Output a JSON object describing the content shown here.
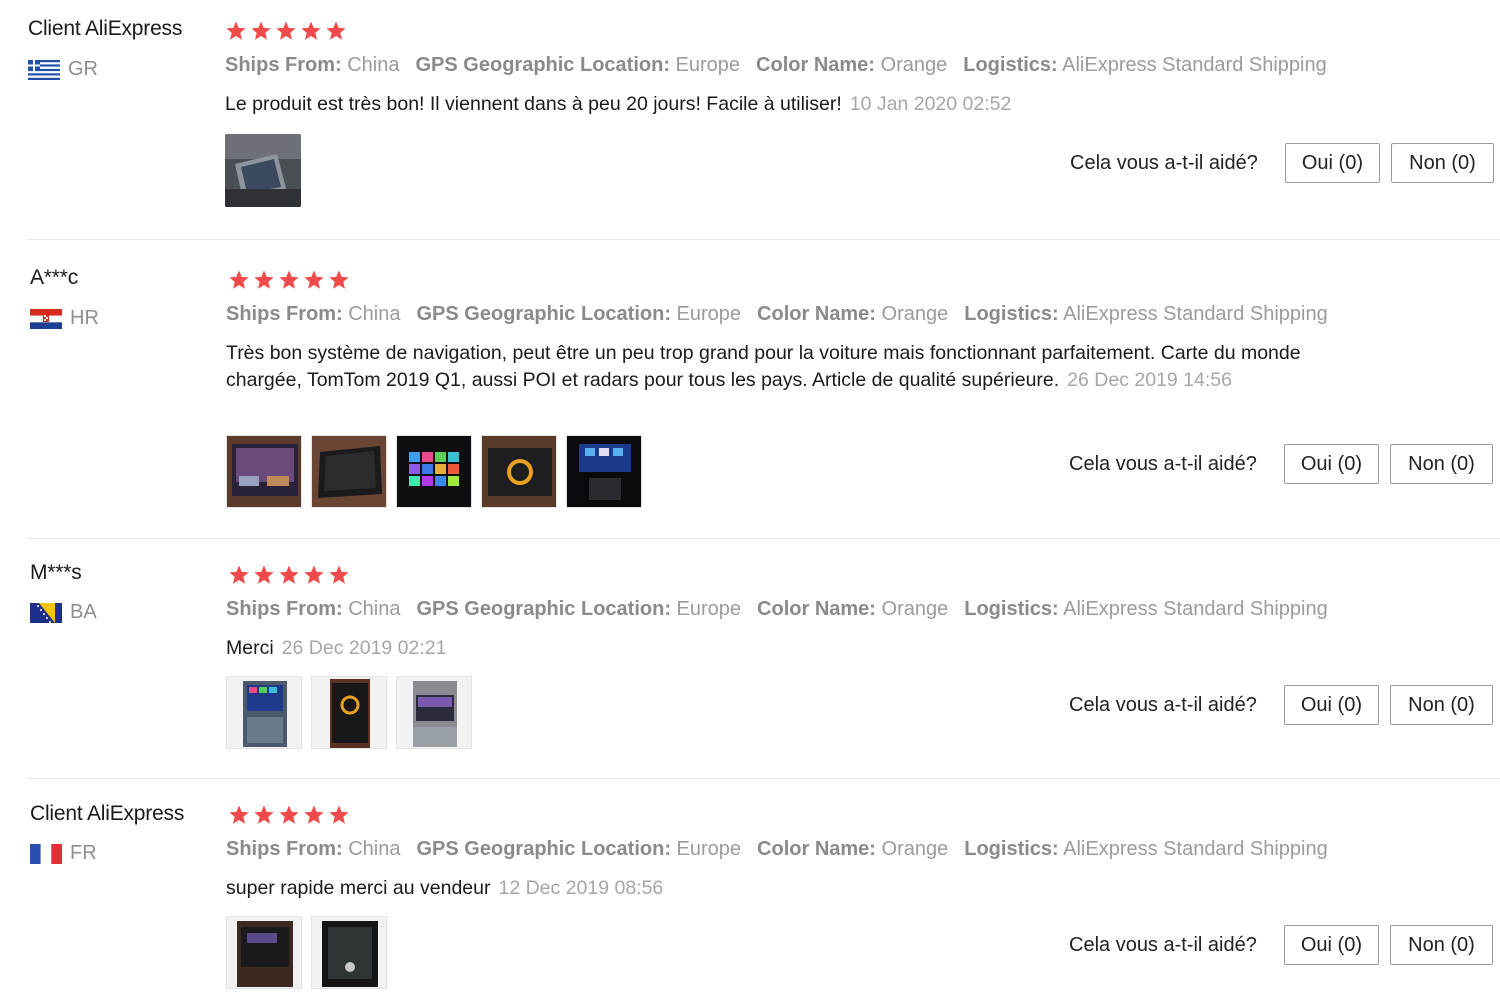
{
  "colors": {
    "star": "#f04a4a",
    "meta": "#9b9b9b",
    "date": "#a6a6a6"
  },
  "helpful_label": "Cela vous a-t-il aidé?",
  "reviews": [
    {
      "user": "Client AliExpress",
      "country_code": "GR",
      "flag_icon": "flag-greece-icon",
      "rating": 5,
      "attributes": [
        {
          "key": "Ships From:",
          "value": "China"
        },
        {
          "key": "GPS Geographic Location:",
          "value": "Europe"
        },
        {
          "key": "Color Name:",
          "value": "Orange"
        },
        {
          "key": "Logistics:",
          "value": "AliExpress Standard Shipping"
        }
      ],
      "text": "Le produit est très bon! Il viennent dans à peu 20 jours! Facile à utiliser!",
      "date": "10 Jan 2020 02:52",
      "photo_count": 1,
      "yes_label": "Oui (0)",
      "no_label": "Non (0)"
    },
    {
      "user": "A***c",
      "country_code": "HR",
      "flag_icon": "flag-croatia-icon",
      "rating": 5,
      "attributes": [
        {
          "key": "Ships From:",
          "value": "China"
        },
        {
          "key": "GPS Geographic Location:",
          "value": "Europe"
        },
        {
          "key": "Color Name:",
          "value": "Orange"
        },
        {
          "key": "Logistics:",
          "value": "AliExpress Standard Shipping"
        }
      ],
      "text": "Très bon système de navigation, peut être un peu trop grand pour la voiture mais fonctionnant parfaitement. Carte du monde chargée, TomTom 2019 Q1, aussi POI et radars pour tous les pays. Article de qualité supérieure.",
      "date": "26 Dec 2019 14:56",
      "photo_count": 5,
      "yes_label": "Oui (0)",
      "no_label": "Non (0)"
    },
    {
      "user": "M***s",
      "country_code": "BA",
      "flag_icon": "flag-bosnia-icon",
      "rating": 5,
      "attributes": [
        {
          "key": "Ships From:",
          "value": "China"
        },
        {
          "key": "GPS Geographic Location:",
          "value": "Europe"
        },
        {
          "key": "Color Name:",
          "value": "Orange"
        },
        {
          "key": "Logistics:",
          "value": "AliExpress Standard Shipping"
        }
      ],
      "text": "Merci",
      "date": "26 Dec 2019 02:21",
      "photo_count": 3,
      "yes_label": "Oui (0)",
      "no_label": "Non (0)"
    },
    {
      "user": "Client AliExpress",
      "country_code": "FR",
      "flag_icon": "flag-france-icon",
      "rating": 5,
      "attributes": [
        {
          "key": "Ships From:",
          "value": "China"
        },
        {
          "key": "GPS Geographic Location:",
          "value": "Europe"
        },
        {
          "key": "Color Name:",
          "value": "Orange"
        },
        {
          "key": "Logistics:",
          "value": "AliExpress Standard Shipping"
        }
      ],
      "text": "super rapide merci au vendeur",
      "date": "12 Dec 2019 08:56",
      "photo_count": 2,
      "yes_label": "Oui (0)",
      "no_label": "Non (0)"
    }
  ]
}
